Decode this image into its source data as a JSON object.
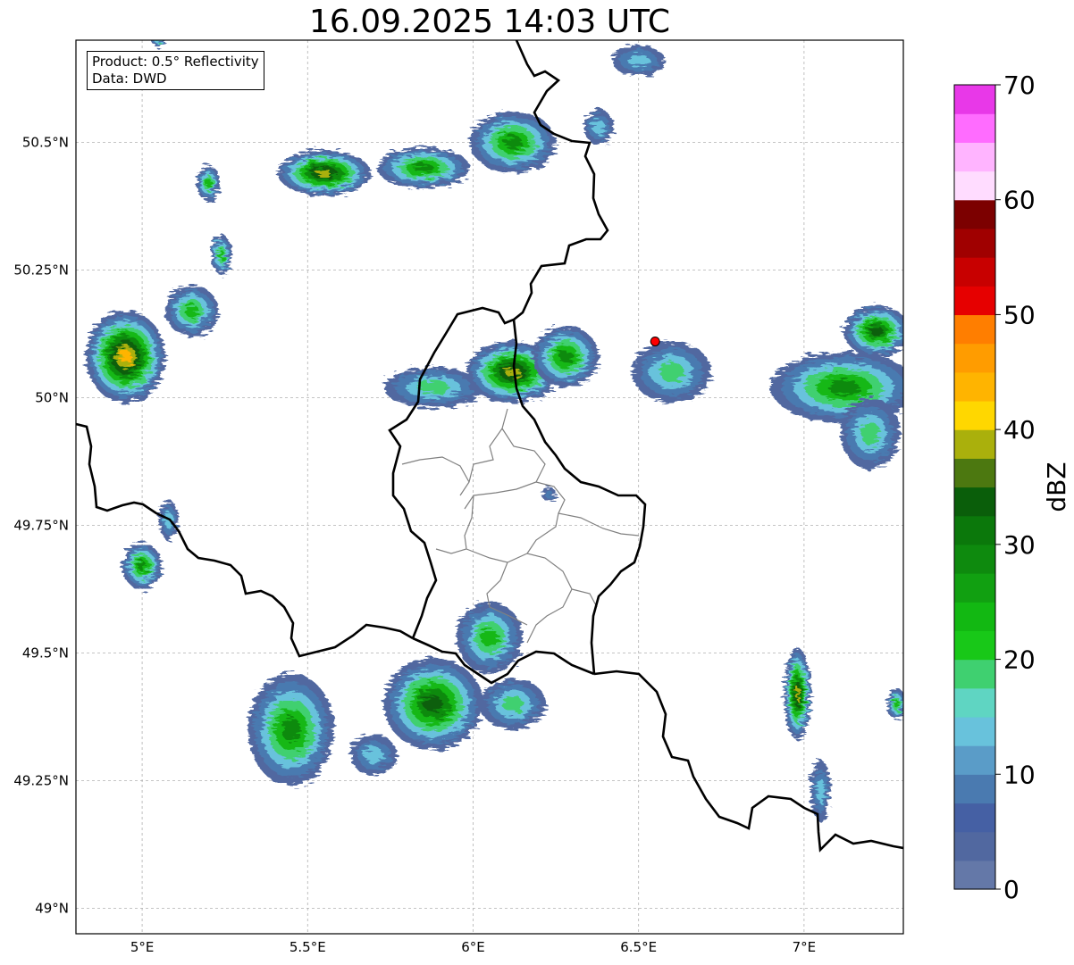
{
  "title": "16.09.2025 14:03 UTC",
  "info": {
    "product": "Product: 0.5° Reflectivity",
    "data": "Data: DWD"
  },
  "map": {
    "lon_range": [
      4.8,
      7.3
    ],
    "lat_range": [
      48.95,
      50.7
    ],
    "lon_ticks": [
      {
        "value": 5.0,
        "label": "5°E"
      },
      {
        "value": 5.5,
        "label": "5.5°E"
      },
      {
        "value": 6.0,
        "label": "6°E"
      },
      {
        "value": 6.5,
        "label": "6.5°E"
      },
      {
        "value": 7.0,
        "label": "7°E"
      }
    ],
    "lat_ticks": [
      {
        "value": 50.5,
        "label": "50.5°N"
      },
      {
        "value": 50.25,
        "label": "50.25°N"
      },
      {
        "value": 50.0,
        "label": "50°N"
      },
      {
        "value": 49.75,
        "label": "49.75°N"
      },
      {
        "value": 49.5,
        "label": "49.5°N"
      },
      {
        "value": 49.25,
        "label": "49.25°N"
      },
      {
        "value": 49.0,
        "label": "49°N"
      }
    ],
    "grid": true,
    "radar_site": {
      "lon": 6.55,
      "lat": 50.11,
      "color": "#ff0000"
    },
    "echo_cells": [
      {
        "lon": 5.55,
        "lat": 50.44,
        "rx": 0.14,
        "ry": 0.045,
        "peak_dbz": 42
      },
      {
        "lon": 5.85,
        "lat": 50.45,
        "rx": 0.14,
        "ry": 0.04,
        "peak_dbz": 32
      },
      {
        "lon": 6.12,
        "lat": 50.5,
        "rx": 0.13,
        "ry": 0.06,
        "peak_dbz": 30
      },
      {
        "lon": 5.2,
        "lat": 50.42,
        "rx": 0.035,
        "ry": 0.035,
        "peak_dbz": 24
      },
      {
        "lon": 5.24,
        "lat": 50.28,
        "rx": 0.03,
        "ry": 0.04,
        "peak_dbz": 24
      },
      {
        "lon": 6.5,
        "lat": 50.66,
        "rx": 0.08,
        "ry": 0.03,
        "peak_dbz": 18
      },
      {
        "lon": 6.38,
        "lat": 50.53,
        "rx": 0.045,
        "ry": 0.035,
        "peak_dbz": 16
      },
      {
        "lon": 4.95,
        "lat": 50.08,
        "rx": 0.12,
        "ry": 0.09,
        "peak_dbz": 44
      },
      {
        "lon": 5.15,
        "lat": 50.17,
        "rx": 0.08,
        "ry": 0.05,
        "peak_dbz": 26
      },
      {
        "lon": 5.88,
        "lat": 50.02,
        "rx": 0.15,
        "ry": 0.04,
        "peak_dbz": 22
      },
      {
        "lon": 6.12,
        "lat": 50.05,
        "rx": 0.14,
        "ry": 0.06,
        "peak_dbz": 42
      },
      {
        "lon": 6.28,
        "lat": 50.08,
        "rx": 0.1,
        "ry": 0.06,
        "peak_dbz": 30
      },
      {
        "lon": 6.6,
        "lat": 50.05,
        "rx": 0.12,
        "ry": 0.06,
        "peak_dbz": 22
      },
      {
        "lon": 7.12,
        "lat": 50.02,
        "rx": 0.22,
        "ry": 0.07,
        "peak_dbz": 30
      },
      {
        "lon": 7.22,
        "lat": 50.13,
        "rx": 0.1,
        "ry": 0.05,
        "peak_dbz": 34
      },
      {
        "lon": 7.2,
        "lat": 49.93,
        "rx": 0.09,
        "ry": 0.07,
        "peak_dbz": 20
      },
      {
        "lon": 5.0,
        "lat": 49.67,
        "rx": 0.06,
        "ry": 0.045,
        "peak_dbz": 30
      },
      {
        "lon": 5.08,
        "lat": 49.76,
        "rx": 0.03,
        "ry": 0.04,
        "peak_dbz": 18
      },
      {
        "lon": 5.45,
        "lat": 49.35,
        "rx": 0.13,
        "ry": 0.11,
        "peak_dbz": 30
      },
      {
        "lon": 5.88,
        "lat": 49.4,
        "rx": 0.15,
        "ry": 0.09,
        "peak_dbz": 34
      },
      {
        "lon": 6.05,
        "lat": 49.53,
        "rx": 0.1,
        "ry": 0.07,
        "peak_dbz": 26
      },
      {
        "lon": 6.12,
        "lat": 49.4,
        "rx": 0.1,
        "ry": 0.05,
        "peak_dbz": 20
      },
      {
        "lon": 5.7,
        "lat": 49.3,
        "rx": 0.07,
        "ry": 0.04,
        "peak_dbz": 16
      },
      {
        "lon": 6.98,
        "lat": 49.42,
        "rx": 0.04,
        "ry": 0.09,
        "peak_dbz": 40
      },
      {
        "lon": 7.05,
        "lat": 49.23,
        "rx": 0.03,
        "ry": 0.06,
        "peak_dbz": 18
      },
      {
        "lon": 7.28,
        "lat": 49.4,
        "rx": 0.03,
        "ry": 0.03,
        "peak_dbz": 24
      },
      {
        "lon": 6.23,
        "lat": 49.81,
        "rx": 0.02,
        "ry": 0.015,
        "peak_dbz": 12
      },
      {
        "lon": 5.05,
        "lat": 50.7,
        "rx": 0.02,
        "ry": 0.015,
        "peak_dbz": 20
      }
    ]
  },
  "colorbar": {
    "label": "dBZ",
    "min": 0,
    "max": 70,
    "colors": [
      "#6478a8",
      "#5168a0",
      "#4560a4",
      "#4a7ab0",
      "#5a9cc8",
      "#68c2dc",
      "#5fd5c2",
      "#3fd070",
      "#18c818",
      "#12b812",
      "#11a011",
      "#0e8a0e",
      "#0b780b",
      "#0a5e0a",
      "#4c7810",
      "#aab00c",
      "#ffd700",
      "#ffb400",
      "#ff9c00",
      "#ff7e00",
      "#e60000",
      "#c80000",
      "#a00000",
      "#7c0000",
      "#ffdcff",
      "#ffb4ff",
      "#ff6cff",
      "#e838e8"
    ],
    "ticks": [
      "0",
      "10",
      "20",
      "30",
      "40",
      "50",
      "60",
      "70"
    ]
  }
}
